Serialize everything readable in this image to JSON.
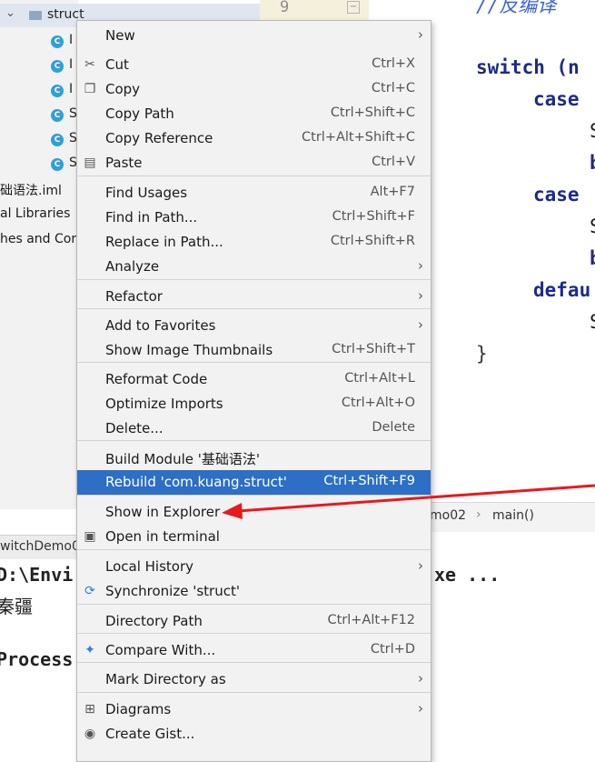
{
  "project_tree": {
    "folder_label": "struct",
    "class_items": [
      "I",
      "I",
      "I",
      "S",
      "S",
      "S"
    ],
    "file_iml": "础语法.iml",
    "external_libraries": "al Libraries",
    "scratches": "hes and Cor"
  },
  "editor": {
    "line_number": "9",
    "comment_text": "//反编译",
    "code_lines": [
      "switch (n",
      "case",
      "S",
      "b",
      "case",
      "S",
      "b",
      "defau",
      "S",
      "}"
    ]
  },
  "breadcrumb": {
    "class_crumb": "mo02",
    "method_crumb": "main()"
  },
  "run_panel": {
    "tab_label": "witchDemo0",
    "line1": "D:\\Envi",
    "line1_suffix": "xe ...",
    "line2": "秦疆",
    "line3": "Process"
  },
  "context_menu": {
    "items": [
      {
        "label": "New",
        "shortcut": "",
        "submenu": true,
        "icon": ""
      },
      {
        "label": "Cut",
        "shortcut": "Ctrl+X",
        "submenu": false,
        "icon": "scissors-icon"
      },
      {
        "label": "Copy",
        "shortcut": "Ctrl+C",
        "submenu": false,
        "icon": "copy-icon"
      },
      {
        "label": "Copy Path",
        "shortcut": "Ctrl+Shift+C",
        "submenu": false,
        "icon": ""
      },
      {
        "label": "Copy Reference",
        "shortcut": "Ctrl+Alt+Shift+C",
        "submenu": false,
        "icon": ""
      },
      {
        "label": "Paste",
        "shortcut": "Ctrl+V",
        "submenu": false,
        "icon": "paste-icon"
      },
      {
        "label": "Find Usages",
        "shortcut": "Alt+F7",
        "submenu": false,
        "icon": ""
      },
      {
        "label": "Find in Path...",
        "shortcut": "Ctrl+Shift+F",
        "submenu": false,
        "icon": ""
      },
      {
        "label": "Replace in Path...",
        "shortcut": "Ctrl+Shift+R",
        "submenu": false,
        "icon": ""
      },
      {
        "label": "Analyze",
        "shortcut": "",
        "submenu": true,
        "icon": ""
      },
      {
        "label": "Refactor",
        "shortcut": "",
        "submenu": true,
        "icon": ""
      },
      {
        "label": "Add to Favorites",
        "shortcut": "",
        "submenu": true,
        "icon": ""
      },
      {
        "label": "Show Image Thumbnails",
        "shortcut": "Ctrl+Shift+T",
        "submenu": false,
        "icon": ""
      },
      {
        "label": "Reformat Code",
        "shortcut": "Ctrl+Alt+L",
        "submenu": false,
        "icon": ""
      },
      {
        "label": "Optimize Imports",
        "shortcut": "Ctrl+Alt+O",
        "submenu": false,
        "icon": ""
      },
      {
        "label": "Delete...",
        "shortcut": "Delete",
        "submenu": false,
        "icon": ""
      },
      {
        "label": "Build Module '基础语法'",
        "shortcut": "",
        "submenu": false,
        "icon": ""
      },
      {
        "label": "Rebuild 'com.kuang.struct'",
        "shortcut": "Ctrl+Shift+F9",
        "submenu": false,
        "icon": ""
      },
      {
        "label": "Show in Explorer",
        "shortcut": "",
        "submenu": false,
        "icon": ""
      },
      {
        "label": "Open in terminal",
        "shortcut": "",
        "submenu": false,
        "icon": "terminal-icon"
      },
      {
        "label": "Local History",
        "shortcut": "",
        "submenu": true,
        "icon": ""
      },
      {
        "label": "Synchronize 'struct'",
        "shortcut": "",
        "submenu": false,
        "icon": "sync-icon"
      },
      {
        "label": "Directory Path",
        "shortcut": "Ctrl+Alt+F12",
        "submenu": false,
        "icon": ""
      },
      {
        "label": "Compare With...",
        "shortcut": "Ctrl+D",
        "submenu": false,
        "icon": "compare-icon"
      },
      {
        "label": "Mark Directory as",
        "shortcut": "",
        "submenu": true,
        "icon": ""
      },
      {
        "label": "Diagrams",
        "shortcut": "",
        "submenu": true,
        "icon": "diagram-icon"
      },
      {
        "label": "Create Gist...",
        "shortcut": "",
        "submenu": false,
        "icon": "github-icon"
      }
    ]
  },
  "colors": {
    "selection": "#2c6fc4",
    "annotation_arrow": "#e8191c",
    "keyword": "#1d2a8a"
  }
}
